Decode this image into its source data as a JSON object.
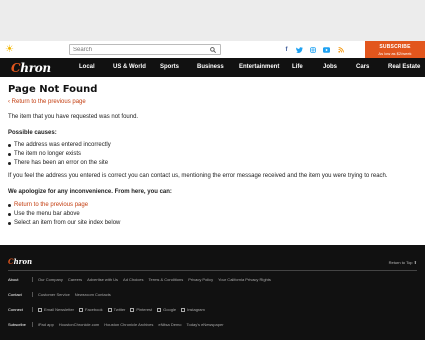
{
  "header": {
    "search_placeholder": "Search",
    "subscribe_line1": "SUBSCRIBE",
    "subscribe_line2": "As low as $2/week",
    "social_icons": [
      "facebook-icon",
      "twitter-icon",
      "instagram-icon",
      "youtube-icon",
      "rss-icon"
    ]
  },
  "nav": {
    "logo": "Chron",
    "items": [
      "Local",
      "US & World",
      "Sports",
      "Business",
      "Entertainment",
      "Life",
      "Jobs",
      "Cars",
      "Real Estate"
    ]
  },
  "main": {
    "title": "Page Not Found",
    "back_link": "Return to the previous page",
    "message": "The item that you have requested was not found.",
    "causes_heading": "Possible causes:",
    "causes": [
      "The address was entered incorrectly",
      "The item no longer exists",
      "There has been an error on the site"
    ],
    "contact_text": "If you feel the address you entered is correct you can contact us, mentioning the error message received and the item you were trying to reach.",
    "apology_heading": "We apologize for any inconvenience. From here, you can:",
    "solutions": [
      "Return to the previous page",
      "Use the menu bar above",
      "Select an item from our site index below"
    ]
  },
  "footer": {
    "logo": "Chron",
    "return_to_top": "Return to Top",
    "rows": [
      {
        "label": "About",
        "links": [
          "Our Company",
          "Careers",
          "Advertise with Us",
          "Ad Choices",
          "Terms & Conditions",
          "Privacy Policy",
          "Your California Privacy Rights"
        ]
      },
      {
        "label": "Contact",
        "links": [
          "Customer Service",
          "Newsroom Contacts"
        ]
      },
      {
        "label": "Connect",
        "links": [
          "Email Newsletter",
          "Facebook",
          "Twitter",
          "Pinterest",
          "Google",
          "Instagram"
        ]
      },
      {
        "label": "Subscribe",
        "links": [
          "iPad app",
          "HoustonChronicle.com",
          "Houston Chronicle Archives",
          "eNitsa Demo",
          "Today's eNewspaper"
        ]
      }
    ]
  },
  "colors": {
    "accent": "#e2561d",
    "link": "#c33d0f",
    "nav_bg": "#111111",
    "ad_bg": "#ececec"
  }
}
